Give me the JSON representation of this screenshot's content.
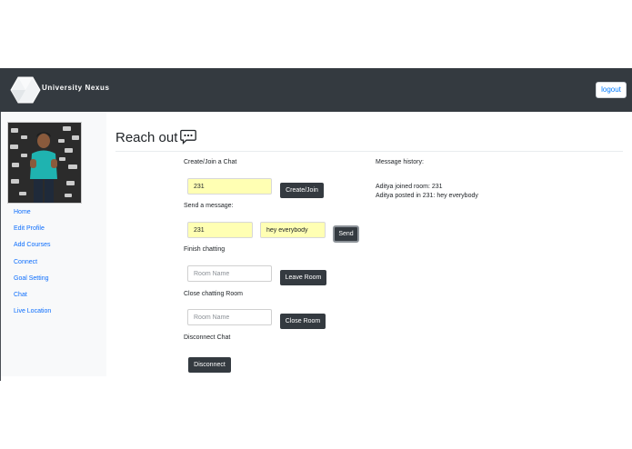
{
  "navbar": {
    "brand_name": "University Nexus",
    "logout_label": "logout",
    "logo_icon": "hexagon-logo-icon"
  },
  "sidebar": {
    "items": [
      {
        "label": "Home"
      },
      {
        "label": "Edit Profile"
      },
      {
        "label": "Add Courses"
      },
      {
        "label": "Connect"
      },
      {
        "label": "Goal Setting"
      },
      {
        "label": "Chat"
      },
      {
        "label": "Live Location"
      }
    ]
  },
  "page": {
    "title": "Reach out",
    "title_icon": "chat-bubble-icon"
  },
  "chat_form": {
    "create_join_label": "Create/Join a Chat",
    "room_value": "231",
    "create_join_button": "Create/Join",
    "send_message_label": "Send a message:",
    "send_room_value": "231",
    "message_value": "hey everybody",
    "send_button": "Send",
    "finish_label": "Finish chatting",
    "leave_placeholder": "Room Name",
    "leave_button": "Leave Room",
    "close_label": "Close chatting Room",
    "close_placeholder": "Room Name",
    "close_button": "Close Room",
    "disconnect_label": "Disconnect Chat",
    "disconnect_button": "Disconnect"
  },
  "history": {
    "title": "Message history:",
    "lines": [
      "Aditya joined room: 231",
      "Aditya posted in 231: hey everybody"
    ]
  },
  "colors": {
    "navbar_bg": "#343a40",
    "link": "#0d6efd",
    "input_highlight": "#ffffb3",
    "button_dark": "#343a40"
  }
}
